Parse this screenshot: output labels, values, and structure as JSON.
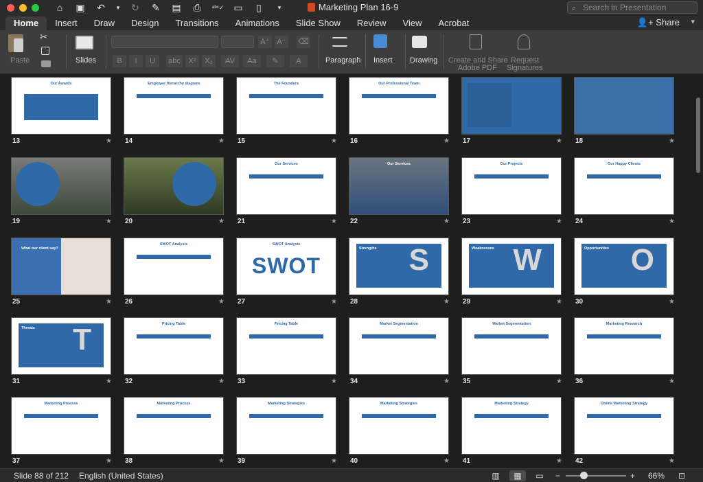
{
  "window": {
    "title": "Marketing Plan 16-9",
    "search_placeholder": "Search in Presentation"
  },
  "traffic_colors": {
    "close": "#fe5f57",
    "minimize": "#febc2e",
    "zoom": "#28c840"
  },
  "quick_access": [
    "home-icon",
    "save-icon",
    "undo-icon",
    "undo-dropdown-icon",
    "redo-icon",
    "edit-icon",
    "picture-icon",
    "print-icon",
    "spelling-icon",
    "present-icon",
    "new-doc-icon",
    "customize-icon"
  ],
  "tabs": [
    "Home",
    "Insert",
    "Draw",
    "Design",
    "Transitions",
    "Animations",
    "Slide Show",
    "Review",
    "View",
    "Acrobat"
  ],
  "active_tab": "Home",
  "share_label": "Share",
  "ribbon": {
    "paste": "Paste",
    "slides": "Slides",
    "paragraph": "Paragraph",
    "insert": "Insert",
    "drawing": "Drawing",
    "create_share_pdf_1": "Create and Share",
    "create_share_pdf_2": "Adobe PDF",
    "request_signatures_1": "Request",
    "request_signatures_2": "Signatures",
    "format_buttons": [
      "B",
      "I",
      "U",
      "abc",
      "X²",
      "X₂",
      "AV",
      "Aa"
    ]
  },
  "slides": [
    {
      "num": "13",
      "title": "Our Awards",
      "style": "white-blue"
    },
    {
      "num": "14",
      "title": "Employee Hierarchy diagram",
      "style": "white"
    },
    {
      "num": "15",
      "title": "The Founders",
      "style": "white"
    },
    {
      "num": "16",
      "title": "Our Professional Team",
      "style": "white"
    },
    {
      "num": "17",
      "title": "",
      "style": "blue-quote"
    },
    {
      "num": "18",
      "title": "",
      "style": "blue-photo"
    },
    {
      "num": "19",
      "title": "",
      "style": "photo"
    },
    {
      "num": "20",
      "title": "",
      "style": "photo-green"
    },
    {
      "num": "21",
      "title": "Our Services",
      "style": "white"
    },
    {
      "num": "22",
      "title": "Our Services",
      "style": "city"
    },
    {
      "num": "23",
      "title": "Our Projects",
      "style": "white"
    },
    {
      "num": "24",
      "title": "Our Happy Clients",
      "style": "white"
    },
    {
      "num": "25",
      "title": "What our client say?",
      "style": "blue-person"
    },
    {
      "num": "26",
      "title": "SWOT Analysis",
      "style": "white"
    },
    {
      "num": "27",
      "title": "SWOT Analysis",
      "style": "swot"
    },
    {
      "num": "28",
      "title": "Strengths",
      "style": "blue-letter"
    },
    {
      "num": "29",
      "title": "Weaknesses",
      "style": "blue-letter"
    },
    {
      "num": "30",
      "title": "Opportunities",
      "style": "blue-letter"
    },
    {
      "num": "31",
      "title": "Threats",
      "style": "blue-letter"
    },
    {
      "num": "32",
      "title": "Pricing Table",
      "style": "white"
    },
    {
      "num": "33",
      "title": "Pricing Table",
      "style": "white"
    },
    {
      "num": "34",
      "title": "Market Segmentation",
      "style": "white"
    },
    {
      "num": "35",
      "title": "Market Segmentation",
      "style": "white"
    },
    {
      "num": "36",
      "title": "Marketing Research",
      "style": "white"
    },
    {
      "num": "37",
      "title": "Marketing Process",
      "style": "white"
    },
    {
      "num": "38",
      "title": "Marketing Process",
      "style": "white"
    },
    {
      "num": "39",
      "title": "Marketing Strategies",
      "style": "white"
    },
    {
      "num": "40",
      "title": "Marketing Strategies",
      "style": "white"
    },
    {
      "num": "41",
      "title": "Marketing Strategy",
      "style": "white"
    },
    {
      "num": "42",
      "title": "Online Marketing Strategy",
      "style": "white"
    }
  ],
  "slide_letters": {
    "28": "S",
    "29": "W",
    "30": "O",
    "31": "T"
  },
  "swot_big": "SWOT",
  "status": {
    "slide_info": "Slide 88 of 212",
    "language": "English (United States)",
    "zoom": "66%"
  }
}
